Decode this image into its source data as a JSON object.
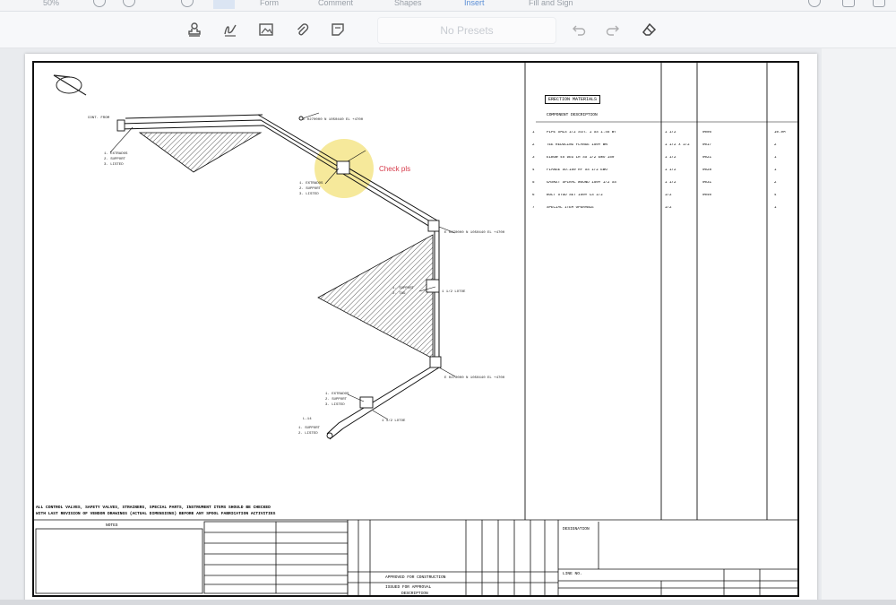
{
  "app": {
    "top_items": [
      "Form",
      "Comment",
      "Shapes",
      "Insert",
      "Fill and Sign"
    ],
    "zoom_label": "50%"
  },
  "toolbar": {
    "presets_label": "No Presets",
    "tools": [
      "stamp-icon",
      "signature-icon",
      "image-icon",
      "attachment-icon",
      "note-icon",
      "undo-icon",
      "redo-icon",
      "eraser-icon"
    ]
  },
  "document": {
    "annotation_note": "Check pls",
    "table_title": "ERECTION MATERIALS",
    "table_header": "COMPONENT DESCRIPTION",
    "rows": [
      {
        "n": "1",
        "desc": "PIPE SMLS 1/2 Sch. 1 SS 1.45 WT",
        "size": "1 1/2",
        "code": "0005",
        "qty": "10.9M"
      },
      {
        "n": "2",
        "desc": "TEE REDUCING FLANGE 150# WN",
        "size": "1 1/2 x 1/2",
        "code": "0017",
        "qty": "2"
      },
      {
        "n": "3",
        "desc": "ELBOW 45 DEG LR SS 1/2 EWO 150",
        "size": "1 1/2",
        "code": "0021",
        "qty": "1"
      },
      {
        "n": "4",
        "desc": "FLANGE SO.150 RF SS 1/2 EWO",
        "size": "1 1/2",
        "code": "0028",
        "qty": "1"
      },
      {
        "n": "5",
        "desc": "GASKET SPIRAL WOUND 150# 1/2 SS",
        "size": "1 1/2",
        "code": "0031",
        "qty": "2"
      },
      {
        "n": "6",
        "desc": "BOLT STUD SET 150# CS 1/2",
        "size": "1/2",
        "code": "0040",
        "qty": "4"
      },
      {
        "n": "7",
        "desc": "SPECIAL ITEM OPERABLE",
        "size": "1/2",
        "code": "",
        "qty": "1"
      }
    ],
    "footer_note_1": "ALL CONTROL VALVES, SAFETY VALVES, STRAINERS, SPECIAL PARTS, INSTRUMENT ITEMS SHOULD BE CHECKED",
    "footer_note_2": "WITH LAST REVISION OF VENDOR DRAWINGS (ACTUAL DIMENSIONS) BEFORE ANY SPOOL FABRICATION ACTIVITIES",
    "title_block": {
      "notes_heading": "NOTES",
      "issue_1": "APPROVED FOR CONSTRUCTION",
      "issue_2": "ISSUED FOR APPROVAL",
      "description_label": "DESCRIPTION",
      "designation_label": "DESIGNATION",
      "line_label": "LINE NO."
    }
  },
  "colors": {
    "highlight": "#f3e27a",
    "annotation": "#d63a4a",
    "ink": "#111111"
  }
}
